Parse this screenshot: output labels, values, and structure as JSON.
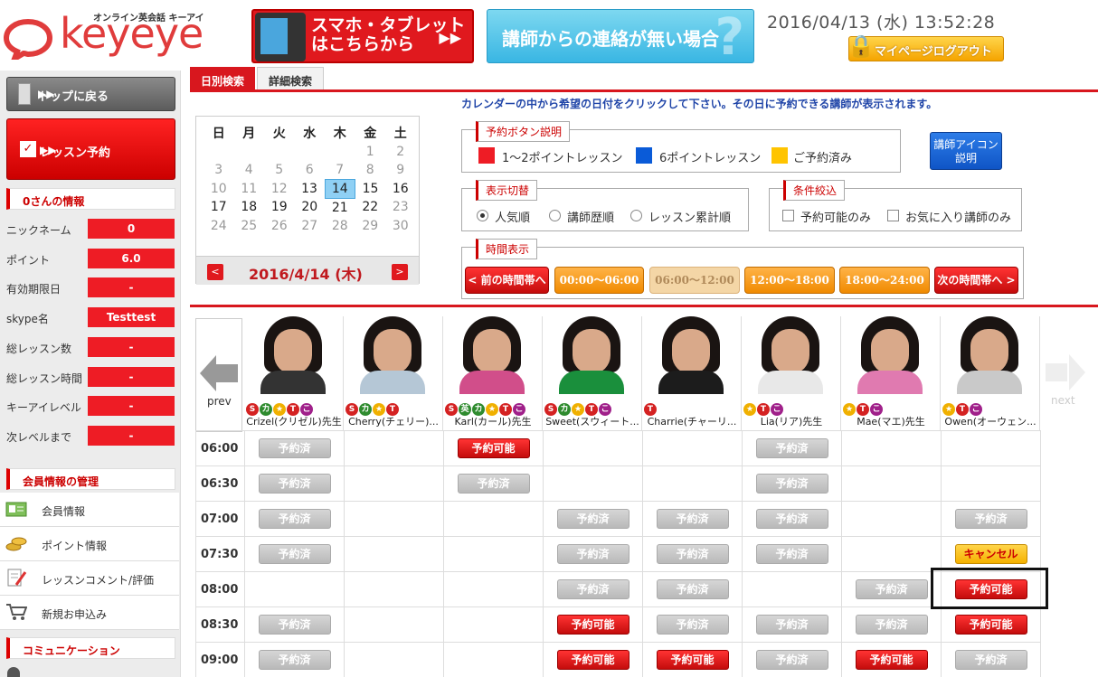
{
  "header": {
    "tagline": "オンライン英会話 キーアイ",
    "logo_text": "keyeye",
    "banner1": "スマホ・タブレット\nはこちらから",
    "banner1_line1": "スマホ・タブレット",
    "banner1_line2": "はこちらから",
    "banner2": "講師からの連絡が無い場合",
    "datetime": "2016/04/13 (水) 13:52:28",
    "logout": "マイページログアウト"
  },
  "sidebar": {
    "top_button": "トップに戻る",
    "lesson_button": "レッスン予約",
    "info_title": "0さんの情報",
    "info": [
      {
        "label": "ニックネーム",
        "value": "0"
      },
      {
        "label": "ポイント",
        "value": "6.0"
      },
      {
        "label": "有効期限日",
        "value": "-"
      },
      {
        "label": "skype名",
        "value": "Testtest"
      },
      {
        "label": "総レッスン数",
        "value": "-"
      },
      {
        "label": "総レッスン時間",
        "value": "-"
      },
      {
        "label": "キーアイレベル",
        "value": "-"
      },
      {
        "label": "次レベルまで",
        "value": "-"
      }
    ],
    "member_title": "会員情報の管理",
    "menu": [
      "会員情報",
      "ポイント情報",
      "レッスンコメント/評価",
      "新規お申込み"
    ],
    "comm_title": "コミュニケーション"
  },
  "tabs": [
    "日別検索",
    "詳細検索"
  ],
  "calendar": {
    "weekdays": [
      "日",
      "月",
      "火",
      "水",
      "木",
      "金",
      "土"
    ],
    "rows": [
      [
        "",
        "",
        "",
        "",
        "",
        "1",
        "2"
      ],
      [
        "3",
        "4",
        "5",
        "6",
        "7",
        "8",
        "9"
      ],
      [
        "10",
        "11",
        "12",
        "13",
        "14",
        "15",
        "16"
      ],
      [
        "17",
        "18",
        "19",
        "20",
        "21",
        "22",
        "23"
      ],
      [
        "24",
        "25",
        "26",
        "27",
        "28",
        "29",
        "30"
      ]
    ],
    "selected_day": "14",
    "date": "2016/4/14 (木)",
    "prev": "<",
    "next": ">"
  },
  "instruction": "カレンダーの中から希望の日付をクリックして下さい。その日に予約できる講師が表示されます。",
  "legend": {
    "title": "予約ボタン説明",
    "items": [
      {
        "label": "1～2ポイントレッスン",
        "color": "#ee1c25"
      },
      {
        "label": "6ポイントレッスン",
        "color": "#0a5bd8"
      },
      {
        "label": "ご予約済み",
        "color": "#ffc400"
      }
    ]
  },
  "icon_help": "講師アイコン\n説明",
  "icon_help_l1": "講師アイコン",
  "icon_help_l2": "説明",
  "display": {
    "title": "表示切替",
    "options": [
      "人気順",
      "講師歴順",
      "レッスン累計順"
    ],
    "selected": "人気順"
  },
  "filter": {
    "title": "条件絞込",
    "options": [
      "予約可能のみ",
      "お気に入り講師のみ"
    ]
  },
  "time_display": {
    "title": "時間表示",
    "buttons": [
      "< 前の時間帯へ",
      "00:00～06:00",
      "06:00～12:00",
      "12:00～18:00",
      "18:00～24:00",
      "次の時間帯へ >"
    ]
  },
  "schedule": {
    "prev": "prev",
    "next": "next",
    "teachers": [
      {
        "name": "Crizel(クリゼル)先生",
        "icons": [
          "S",
          "カ",
          "★",
          "T",
          "こ"
        ],
        "shirt": "#333"
      },
      {
        "name": "Cherry(チェリー)...",
        "icons": [
          "S",
          "カ",
          "★",
          "T"
        ],
        "shirt": "#b5c7d6"
      },
      {
        "name": "Karl(カール)先生",
        "icons": [
          "S",
          "英",
          "カ",
          "★",
          "T",
          "こ"
        ],
        "shirt": "#d14e8a"
      },
      {
        "name": "Sweet(スウィート...",
        "icons": [
          "S",
          "カ",
          "★",
          "T",
          "こ"
        ],
        "shirt": "#1a8f3c"
      },
      {
        "name": "Charrie(チャーリ...",
        "icons": [
          "T"
        ],
        "shirt": "#1c1c1c"
      },
      {
        "name": "Lia(リア)先生",
        "icons": [
          "★",
          "T",
          "こ"
        ],
        "shirt": "#e8e8e8"
      },
      {
        "name": "Mae(マエ)先生",
        "icons": [
          "★",
          "T",
          "こ"
        ],
        "shirt": "#e07ab0"
      },
      {
        "name": "Owen(オーウェン...",
        "icons": [
          "★",
          "T",
          "こ"
        ],
        "shirt": "#c9c9c9"
      }
    ],
    "times": [
      "06:00",
      "06:30",
      "07:00",
      "07:30",
      "08:00",
      "08:30",
      "09:00"
    ],
    "labels": {
      "done": "予約済",
      "ok": "予約可能",
      "cancel": "キャンセル"
    },
    "grid": [
      [
        "done",
        "",
        "ok",
        "",
        "",
        "done",
        "",
        ""
      ],
      [
        "done",
        "",
        "done",
        "",
        "",
        "done",
        "",
        ""
      ],
      [
        "done",
        "",
        "",
        "done",
        "done",
        "done",
        "",
        "done"
      ],
      [
        "done",
        "",
        "",
        "done",
        "done",
        "done",
        "",
        "cancel"
      ],
      [
        "",
        "",
        "",
        "done",
        "done",
        "",
        "done",
        "ok"
      ],
      [
        "done",
        "",
        "",
        "ok",
        "done",
        "done",
        "done",
        "ok"
      ],
      [
        "done",
        "",
        "",
        "ok",
        "ok",
        "done",
        "ok",
        "done"
      ]
    ]
  }
}
